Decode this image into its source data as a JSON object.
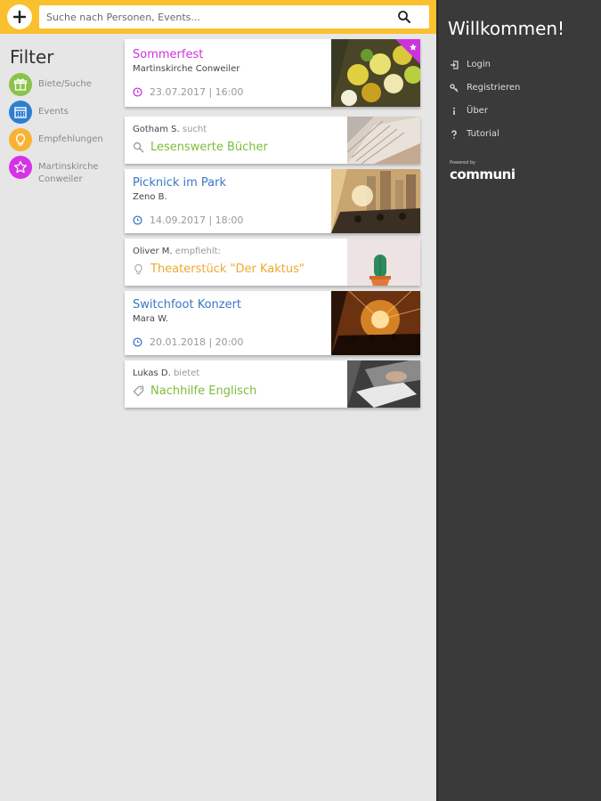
{
  "search": {
    "placeholder": "Suche nach Personen, Events..."
  },
  "filter": {
    "title": "Filter",
    "items": [
      {
        "label": "Biete/Suche",
        "color": "#8bc34a",
        "icon": "gift-icon"
      },
      {
        "label": "Events",
        "color": "#2f7fd0",
        "icon": "calendar-icon"
      },
      {
        "label": "Empfehlungen",
        "color": "#f9b233",
        "icon": "lightbulb-icon"
      },
      {
        "label": "Martinskirche Conweiler",
        "color": "#d633e6",
        "icon": "star-icon"
      }
    ]
  },
  "cards": [
    {
      "title": "Sommerfest",
      "subtitle": "Martinskirche Conweiler",
      "meta": "23.07.2017 | 16:00",
      "title_color": "#cc33dd"
    },
    {
      "user": "Gotham S.",
      "verb": "sucht",
      "big": "Lesenswerte Bücher",
      "big_color": "#7cbd3a"
    },
    {
      "title": "Picknick im Park",
      "subtitle": "Zeno B.",
      "meta": "14.09.2017 | 18:00",
      "title_color": "#3a78c2"
    },
    {
      "user": "Oliver M.",
      "verb": "empfiehlt:",
      "big": "Theaterstück \"Der Kaktus\"",
      "big_color": "#f0a830"
    },
    {
      "title": "Switchfoot Konzert",
      "subtitle": "Mara W.",
      "meta": "20.01.2018 | 20:00",
      "title_color": "#3a78c2"
    },
    {
      "user": "Lukas D.",
      "verb": "bietet",
      "big": "Nachhilfe Englisch",
      "big_color": "#7cbd3a"
    }
  ],
  "drawer": {
    "welcome": "Willkommen!",
    "menu": [
      {
        "label": "Login",
        "icon": "login-icon"
      },
      {
        "label": "Registrieren",
        "icon": "key-icon"
      },
      {
        "label": "Über",
        "icon": "info-icon"
      },
      {
        "label": "Tutorial",
        "icon": "help-icon"
      }
    ],
    "logo_small": "Powered by",
    "logo_text": "communi"
  }
}
